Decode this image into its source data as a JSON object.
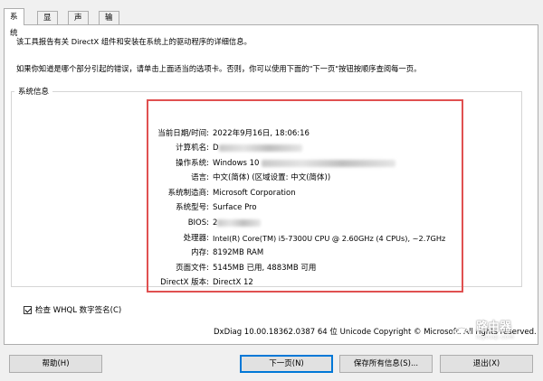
{
  "tabs": [
    {
      "label": "系统"
    },
    {
      "label": "显示"
    },
    {
      "label": "声音"
    },
    {
      "label": "输入"
    }
  ],
  "intro": {
    "line1": "该工具报告有关 DirectX 组件和安装在系统上的驱动程序的详细信息。",
    "line2": "如果你知道是哪个部分引起的错误，请单击上面适当的选项卡。否则，你可以使用下面的\"下一页\"按钮按顺序查阅每一页。"
  },
  "system_info": {
    "title": "系统信息",
    "rows": [
      {
        "label": "当前日期/时间:",
        "value": "2022年9月16日, 18:06:16"
      },
      {
        "label": "计算机名:",
        "value": "D"
      },
      {
        "label": "操作系统:",
        "value": "Windows 10"
      },
      {
        "label": "语言:",
        "value": "中文(简体) (区域设置: 中文(简体))"
      },
      {
        "label": "系统制造商:",
        "value": "Microsoft Corporation"
      },
      {
        "label": "系统型号:",
        "value": "Surface Pro"
      },
      {
        "label": "BIOS:",
        "value": "2"
      },
      {
        "label": "处理器:",
        "value": "Intel(R) Core(TM) i5-7300U CPU @ 2.60GHz (4 CPUs), ~2.7GHz"
      },
      {
        "label": "内存:",
        "value": "8192MB RAM"
      },
      {
        "label": "页面文件:",
        "value": "5145MB 已用, 4883MB 可用"
      },
      {
        "label": "DirectX 版本:",
        "value": "DirectX 12"
      }
    ]
  },
  "whql_checkbox": {
    "label": "检查 WHQL 数字签名(C)",
    "checked": true
  },
  "footer": {
    "text": "DxDiag 10.00.18362.0387 64 位 Unicode  Copyright © Microsoft. All rights reserved."
  },
  "buttons": {
    "help": "帮助(H)",
    "next": "下一页(N)",
    "save": "保存所有信息(S)...",
    "exit": "退出(X)"
  },
  "watermark": {
    "text": "路由器",
    "sub": "luyouqi.com"
  },
  "colors": {
    "highlight_border": "#e05050",
    "default_button_border": "#0078d7"
  }
}
